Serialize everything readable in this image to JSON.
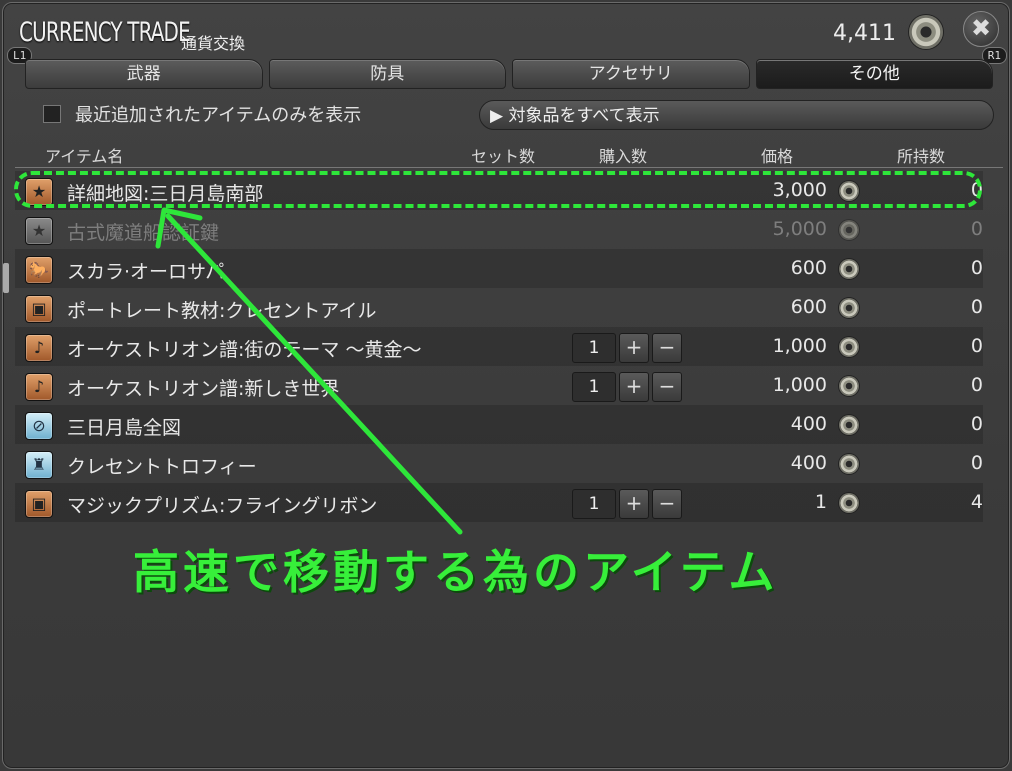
{
  "header": {
    "title": "CURRENCY TRADE",
    "subtitle": "通貨交換",
    "currency_amount": "4,411",
    "left_badge": "L1",
    "right_badge": "R1",
    "close_glyph": "✖"
  },
  "tabs": [
    {
      "label": "武器",
      "active": false
    },
    {
      "label": "防具",
      "active": false
    },
    {
      "label": "アクセサリ",
      "active": false
    },
    {
      "label": "その他",
      "active": true
    }
  ],
  "filter": {
    "checkbox_label": "最近追加されたアイテムのみを表示",
    "show_all_label": "▶ 対象品をすべて表示"
  },
  "columns": {
    "name": "アイテム名",
    "set": "セット数",
    "buy": "購入数",
    "price": "価格",
    "owned": "所持数"
  },
  "items": [
    {
      "icon": "star-icon",
      "glyph": "★",
      "name": "詳細地図:三日月島南部",
      "qty": "",
      "price": "3,000",
      "owned": "0",
      "dim": false
    },
    {
      "icon": "star-icon",
      "glyph": "★",
      "name": "古式魔道船認証鍵",
      "qty": "",
      "price": "5,000",
      "owned": "0",
      "dim": true
    },
    {
      "icon": "mount-icon",
      "glyph": "🐎",
      "name": "スカラ·オーロサパ",
      "qty": "",
      "price": "600",
      "owned": "0",
      "dim": false
    },
    {
      "icon": "chest-icon",
      "glyph": "▣",
      "name": "ポートレート教材:クレセントアイル",
      "qty": "",
      "price": "600",
      "owned": "0",
      "dim": false
    },
    {
      "icon": "music-note-icon",
      "glyph": "♪",
      "name": "オーケストリオン譜:街のテーマ ～黄金～",
      "qty": "1",
      "price": "1,000",
      "owned": "0",
      "dim": false
    },
    {
      "icon": "music-note-icon",
      "glyph": "♪",
      "name": "オーケストリオン譜:新しき世界",
      "qty": "1",
      "price": "1,000",
      "owned": "0",
      "dim": false
    },
    {
      "icon": "map-icon",
      "glyph": "⊘",
      "name": "三日月島全図",
      "qty": "",
      "price": "400",
      "owned": "0",
      "dim": false
    },
    {
      "icon": "trophy-icon",
      "glyph": "♜",
      "name": "クレセントトロフィー",
      "qty": "",
      "price": "400",
      "owned": "0",
      "dim": false
    },
    {
      "icon": "chest-icon",
      "glyph": "▣",
      "name": "マジックプリズム:フライングリボン",
      "qty": "1",
      "price": "1",
      "owned": "4",
      "dim": false
    }
  ],
  "annotation": {
    "text": "高速で移動する為のアイテム",
    "color": "#37ef3a"
  }
}
